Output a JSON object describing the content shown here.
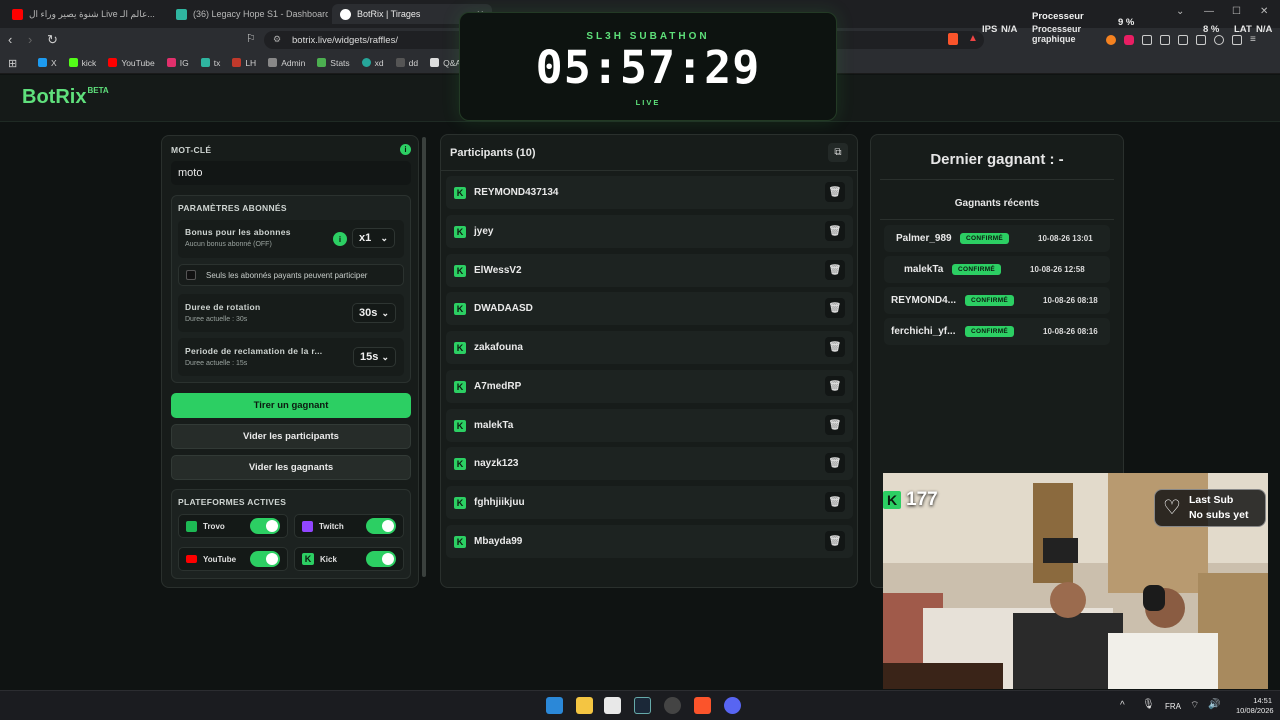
{
  "browser": {
    "tabs": [
      {
        "label": "شنوة يصير وراء ال Live عالم الـ...",
        "color": "#ff0000"
      },
      {
        "label": "(36) Legacy Hope S1 - Dashboard",
        "color": "#2fb5a0"
      },
      {
        "label": "BotRix | Tirages",
        "color": "#ffffff"
      }
    ],
    "url": "botrix.live/widgets/raffles/",
    "bookmarks": [
      {
        "label": "X",
        "color": "#1d9bf0"
      },
      {
        "label": "kick",
        "color": "#53fc18"
      },
      {
        "label": "YouTube",
        "color": "#ff0000"
      },
      {
        "label": "IG",
        "color": "#e1306c"
      },
      {
        "label": "tx",
        "color": "#2fb5a0"
      },
      {
        "label": "LH",
        "color": "#c0392b"
      },
      {
        "label": "Admin",
        "color": "#888888"
      },
      {
        "label": "Stats",
        "color": "#4caf50"
      },
      {
        "label": "xd",
        "color": "#26a69a"
      },
      {
        "label": "dd",
        "color": "#555555"
      },
      {
        "label": "Q&A",
        "color": "#dddddd"
      }
    ],
    "perf": {
      "cpu_label": "Processeur",
      "cpu_value": "9 %",
      "gpu_label": "Processeur graphique",
      "gpu_value": "8 %",
      "ips_label": "IPS",
      "ips_value": "N/A",
      "lat_label": "LAT",
      "lat_value": "N/A"
    }
  },
  "overlay": {
    "title": "SL3H SUBATHON",
    "timer": "05:57:29",
    "status": "LIVE"
  },
  "app": {
    "logo": "BotRix",
    "logo_badge": "BETA"
  },
  "settings": {
    "keyword_label": "MOT-CLÉ",
    "keyword_value": "moto",
    "subs_section": "PARAMÈTRES ABONNÉS",
    "bonus_title": "Bonus pour les abonnes",
    "bonus_sub": "Aucun bonus abonné (OFF)",
    "bonus_value": "x1",
    "paid_only": "Seuls les abonnés payants peuvent participer",
    "rotation_title": "Duree de rotation",
    "rotation_sub": "Duree actuelle : 30s",
    "rotation_value": "30s",
    "claim_title": "Periode de reclamation de la r...",
    "claim_sub": "Duree actuelle : 15s",
    "claim_value": "15s",
    "draw_button": "Tirer un gagnant",
    "clear_participants": "Vider les participants",
    "clear_winners": "Vider les gagnants",
    "platforms_section": "PLATEFORMES ACTIVES",
    "platforms": [
      {
        "name": "Trovo",
        "color": "#1db954"
      },
      {
        "name": "Twitch",
        "color": "#9146ff"
      },
      {
        "name": "YouTube",
        "color": "#ff0000"
      },
      {
        "name": "Kick",
        "color": "#53fc18"
      }
    ]
  },
  "participants": {
    "title": "Participants (10)",
    "list": [
      "REYMOND437134",
      "jyey",
      "ElWessV2",
      "DWADAASD",
      "zakafouna",
      "A7medRP",
      "malekTa",
      "nayzk123",
      "fghhjiikjuu",
      "Mbayda99"
    ]
  },
  "winners": {
    "last_winner": "Dernier gagnant : -",
    "recent_title": "Gagnants récents",
    "recent": [
      {
        "name": "Palmer_989",
        "status": "CONFIRMÉ",
        "date": "10-08-26 13:01"
      },
      {
        "name": "malekTa",
        "status": "CONFIRMÉ",
        "date": "10-08-26 12:58"
      },
      {
        "name": "REYMOND4...",
        "status": "CONFIRMÉ",
        "date": "10-08-26 08:18"
      },
      {
        "name": "ferchichi_yf...",
        "status": "CONFIRMÉ",
        "date": "10-08-26 08:16"
      }
    ]
  },
  "webcam": {
    "kick_count": "177",
    "last_sub_title": "Last Sub",
    "last_sub_value": "No subs yet"
  },
  "taskbar": {
    "lang": "FRA",
    "time": "14:51",
    "date": "10/08/2026"
  }
}
